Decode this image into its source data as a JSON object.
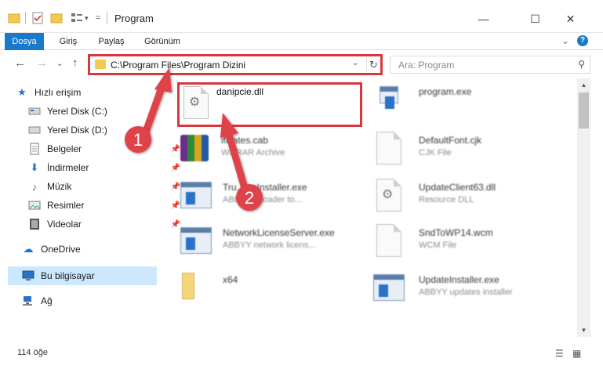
{
  "window": {
    "title": "Program",
    "minimize": "—",
    "maximize": "☐",
    "close": "✕"
  },
  "ribbon": {
    "tabs": [
      "Dosya",
      "Giriş",
      "Paylaş",
      "Görünüm"
    ],
    "expand": "⌄",
    "help": "?"
  },
  "nav": {
    "back": "←",
    "forward": "→",
    "recent": "⌄",
    "up": "↑",
    "address": "C:\\Program Files\\Program Dizini",
    "refresh": "↻",
    "search_placeholder": "Ara: Program"
  },
  "sidebar": {
    "items": [
      {
        "label": "Hızlı erişim",
        "icon": "star-icon"
      },
      {
        "label": "Yerel Disk (C:)",
        "icon": "drive-icon"
      },
      {
        "label": "Yerel Disk (D:)",
        "icon": "drive-icon"
      },
      {
        "label": "Belgeler",
        "icon": "documents-icon"
      },
      {
        "label": "İndirmeler",
        "icon": "downloads-icon"
      },
      {
        "label": "Müzik",
        "icon": "music-icon"
      },
      {
        "label": "Resimler",
        "icon": "pictures-icon"
      },
      {
        "label": "Videolar",
        "icon": "videos-icon"
      },
      {
        "label": "OneDrive",
        "icon": "cloud-icon"
      },
      {
        "label": "Bu bilgisayar",
        "icon": "computer-icon"
      },
      {
        "label": "Ağ",
        "icon": "network-icon"
      }
    ]
  },
  "files": [
    {
      "name": "danipcie.dll",
      "type": ""
    },
    {
      "name": "program.exe",
      "type": ""
    },
    {
      "name": "ificates.cab",
      "type": "WinRAR Archive"
    },
    {
      "name": "DefaultFont.cjk",
      "type": "CJK File"
    },
    {
      "name": "Tru...msInstaller.exe",
      "type": "ABBYY ...loader to..."
    },
    {
      "name": "UpdateClient63.dll",
      "type": "Resource DLL"
    },
    {
      "name": "NetworkLicenseServer.exe",
      "type": "ABBYY network licens..."
    },
    {
      "name": "SndToWP14.wcm",
      "type": "WCM File"
    },
    {
      "name": "x64",
      "type": ""
    },
    {
      "name": "UpdateInstaller.exe",
      "type": "ABBYY updates installer"
    }
  ],
  "annotations": {
    "badge1": "1",
    "badge2": "2"
  },
  "status": {
    "count": "114 öğe"
  },
  "colors": {
    "accent": "#1979ca",
    "highlight": "#d9363e",
    "selected": "#cce8ff"
  }
}
